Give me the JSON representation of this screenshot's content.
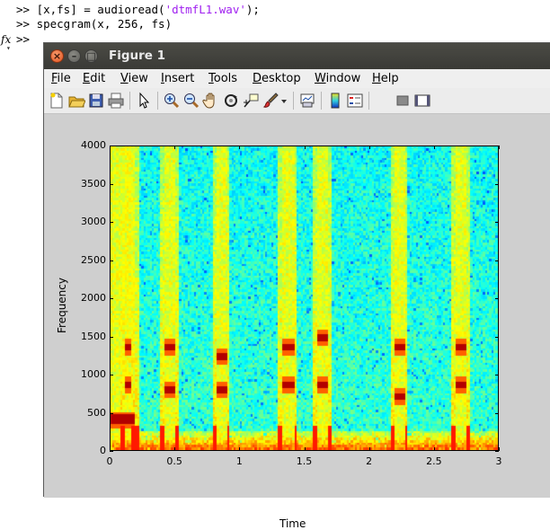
{
  "console": {
    "lines": [
      {
        "prompt": ">> ",
        "before": "[x,fs] = audioread(",
        "string": "'dtmfL1.wav'",
        "after": ");"
      },
      {
        "prompt": ">> ",
        "before": "specgram(x, 256, fs)",
        "string": "",
        "after": ""
      },
      {
        "prompt": ">> ",
        "before": "",
        "string": "",
        "after": ""
      }
    ],
    "fx_label": "fx",
    "caret_glyph": "▾",
    "string_color": "#a020f0"
  },
  "window": {
    "title": "Figure 1",
    "buttons": {
      "close": "×",
      "minimize": "–",
      "maximize": "□"
    }
  },
  "menubar": {
    "items": [
      "File",
      "Edit",
      "View",
      "Insert",
      "Tools",
      "Desktop",
      "Window",
      "Help"
    ]
  },
  "toolbar": {
    "icons": [
      "new-figure-icon",
      "open-file-icon",
      "save-icon",
      "print-icon",
      "pointer-icon",
      "zoom-in-icon",
      "zoom-out-icon",
      "pan-hand-icon",
      "rotate-3d-icon",
      "data-cursor-icon",
      "brush-icon",
      "dropdown-arrow-icon",
      "link-plot-icon",
      "colorbar-icon",
      "legend-icon",
      "hide-plot-tools-icon",
      "show-plot-tools-icon"
    ]
  },
  "chart_data": {
    "type": "heatmap",
    "title": "",
    "xlabel": "Time",
    "ylabel": "Frequency",
    "xlim": [
      0,
      3
    ],
    "ylim": [
      0,
      4000
    ],
    "x_ticks": [
      "0",
      "0.5",
      "1",
      "1.5",
      "2",
      "2.5",
      "3"
    ],
    "y_ticks": [
      "0",
      "500",
      "1000",
      "1500",
      "2000",
      "2500",
      "3000",
      "3500",
      "4000"
    ],
    "colormap": "jet",
    "tones": [
      {
        "t_start": 0.0,
        "t_end": 0.2,
        "low_hz": 400,
        "high_hz": 400
      },
      {
        "t_start": 0.11,
        "t_end": 0.17,
        "low_hz": 850,
        "high_hz": 1340
      },
      {
        "t_start": 0.42,
        "t_end": 0.51,
        "low_hz": 800,
        "high_hz": 1340
      },
      {
        "t_start": 0.82,
        "t_end": 0.9,
        "low_hz": 800,
        "high_hz": 1220
      },
      {
        "t_start": 1.33,
        "t_end": 1.42,
        "low_hz": 850,
        "high_hz": 1340
      },
      {
        "t_start": 1.6,
        "t_end": 1.69,
        "low_hz": 850,
        "high_hz": 1480
      },
      {
        "t_start": 2.2,
        "t_end": 2.28,
        "low_hz": 700,
        "high_hz": 1340
      },
      {
        "t_start": 2.67,
        "t_end": 2.76,
        "low_hz": 850,
        "high_hz": 1340
      }
    ],
    "background_color": "#1ec0e8"
  }
}
